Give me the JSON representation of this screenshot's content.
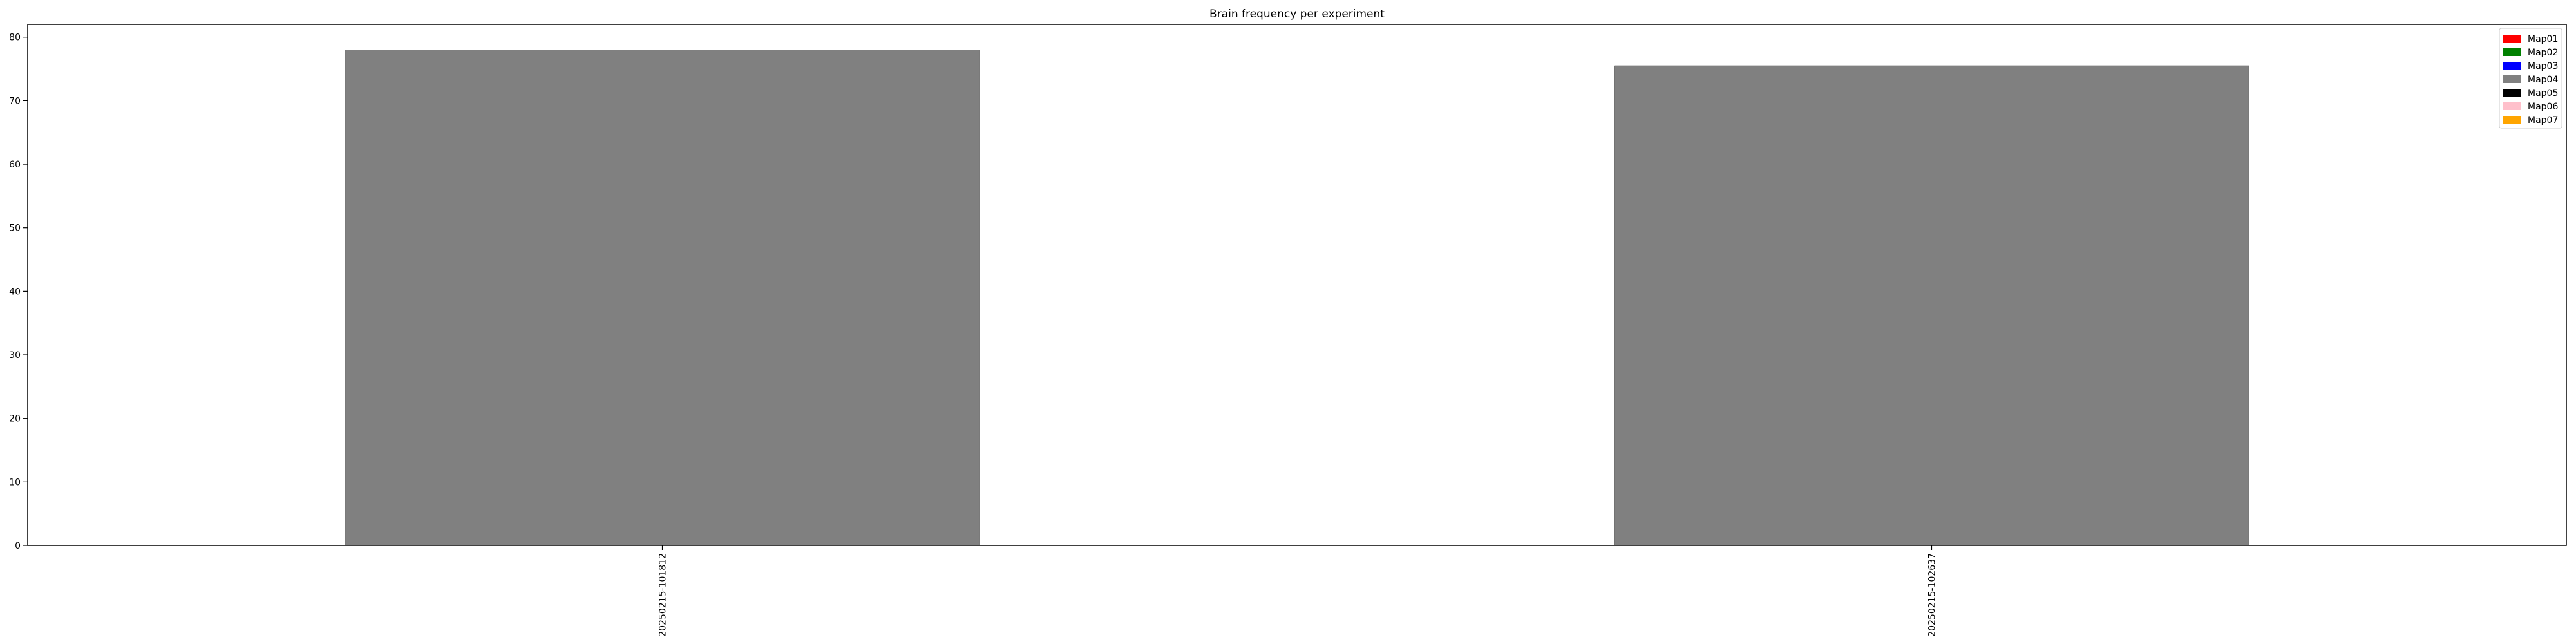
{
  "chart_data": {
    "type": "bar",
    "title": "Brain frequency per experiment",
    "xlabel": "",
    "ylabel": "",
    "categories": [
      "20250215-101812",
      "20250215-102637"
    ],
    "series": [
      {
        "name": "Map01",
        "color": "#ff0000",
        "values": [
          0,
          0
        ]
      },
      {
        "name": "Map02",
        "color": "#008000",
        "values": [
          0,
          0
        ]
      },
      {
        "name": "Map03",
        "color": "#0000ff",
        "values": [
          0,
          0
        ]
      },
      {
        "name": "Map04",
        "color": "#808080",
        "values": [
          78,
          75.5
        ]
      },
      {
        "name": "Map05",
        "color": "#000000",
        "values": [
          0,
          0
        ]
      },
      {
        "name": "Map06",
        "color": "#ffc0cb",
        "values": [
          0,
          0
        ]
      },
      {
        "name": "Map07",
        "color": "#ffa500",
        "values": [
          0,
          0
        ]
      }
    ],
    "stacked": true,
    "ylim": [
      0,
      82
    ],
    "yticks": [
      0,
      10,
      20,
      30,
      40,
      50,
      60,
      70,
      80
    ],
    "grid": false,
    "legend_position": "top-right"
  }
}
